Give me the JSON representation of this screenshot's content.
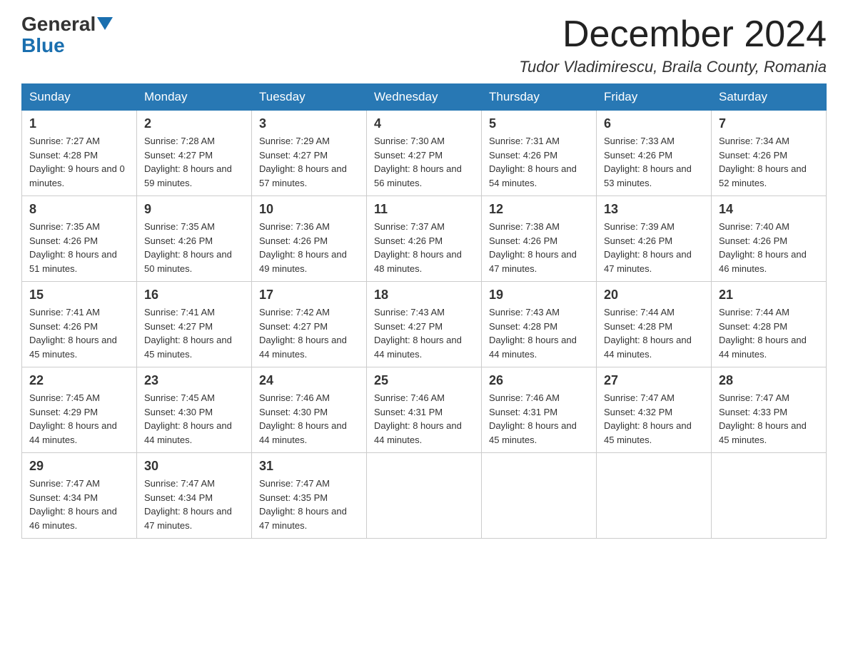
{
  "header": {
    "logo_line1": "General",
    "logo_line2": "Blue",
    "month_title": "December 2024",
    "location": "Tudor Vladimirescu, Braila County, Romania"
  },
  "calendar": {
    "headers": [
      "Sunday",
      "Monday",
      "Tuesday",
      "Wednesday",
      "Thursday",
      "Friday",
      "Saturday"
    ],
    "weeks": [
      [
        {
          "day": "1",
          "sunrise": "7:27 AM",
          "sunset": "4:28 PM",
          "daylight": "9 hours and 0 minutes."
        },
        {
          "day": "2",
          "sunrise": "7:28 AM",
          "sunset": "4:27 PM",
          "daylight": "8 hours and 59 minutes."
        },
        {
          "day": "3",
          "sunrise": "7:29 AM",
          "sunset": "4:27 PM",
          "daylight": "8 hours and 57 minutes."
        },
        {
          "day": "4",
          "sunrise": "7:30 AM",
          "sunset": "4:27 PM",
          "daylight": "8 hours and 56 minutes."
        },
        {
          "day": "5",
          "sunrise": "7:31 AM",
          "sunset": "4:26 PM",
          "daylight": "8 hours and 54 minutes."
        },
        {
          "day": "6",
          "sunrise": "7:33 AM",
          "sunset": "4:26 PM",
          "daylight": "8 hours and 53 minutes."
        },
        {
          "day": "7",
          "sunrise": "7:34 AM",
          "sunset": "4:26 PM",
          "daylight": "8 hours and 52 minutes."
        }
      ],
      [
        {
          "day": "8",
          "sunrise": "7:35 AM",
          "sunset": "4:26 PM",
          "daylight": "8 hours and 51 minutes."
        },
        {
          "day": "9",
          "sunrise": "7:35 AM",
          "sunset": "4:26 PM",
          "daylight": "8 hours and 50 minutes."
        },
        {
          "day": "10",
          "sunrise": "7:36 AM",
          "sunset": "4:26 PM",
          "daylight": "8 hours and 49 minutes."
        },
        {
          "day": "11",
          "sunrise": "7:37 AM",
          "sunset": "4:26 PM",
          "daylight": "8 hours and 48 minutes."
        },
        {
          "day": "12",
          "sunrise": "7:38 AM",
          "sunset": "4:26 PM",
          "daylight": "8 hours and 47 minutes."
        },
        {
          "day": "13",
          "sunrise": "7:39 AM",
          "sunset": "4:26 PM",
          "daylight": "8 hours and 47 minutes."
        },
        {
          "day": "14",
          "sunrise": "7:40 AM",
          "sunset": "4:26 PM",
          "daylight": "8 hours and 46 minutes."
        }
      ],
      [
        {
          "day": "15",
          "sunrise": "7:41 AM",
          "sunset": "4:26 PM",
          "daylight": "8 hours and 45 minutes."
        },
        {
          "day": "16",
          "sunrise": "7:41 AM",
          "sunset": "4:27 PM",
          "daylight": "8 hours and 45 minutes."
        },
        {
          "day": "17",
          "sunrise": "7:42 AM",
          "sunset": "4:27 PM",
          "daylight": "8 hours and 44 minutes."
        },
        {
          "day": "18",
          "sunrise": "7:43 AM",
          "sunset": "4:27 PM",
          "daylight": "8 hours and 44 minutes."
        },
        {
          "day": "19",
          "sunrise": "7:43 AM",
          "sunset": "4:28 PM",
          "daylight": "8 hours and 44 minutes."
        },
        {
          "day": "20",
          "sunrise": "7:44 AM",
          "sunset": "4:28 PM",
          "daylight": "8 hours and 44 minutes."
        },
        {
          "day": "21",
          "sunrise": "7:44 AM",
          "sunset": "4:28 PM",
          "daylight": "8 hours and 44 minutes."
        }
      ],
      [
        {
          "day": "22",
          "sunrise": "7:45 AM",
          "sunset": "4:29 PM",
          "daylight": "8 hours and 44 minutes."
        },
        {
          "day": "23",
          "sunrise": "7:45 AM",
          "sunset": "4:30 PM",
          "daylight": "8 hours and 44 minutes."
        },
        {
          "day": "24",
          "sunrise": "7:46 AM",
          "sunset": "4:30 PM",
          "daylight": "8 hours and 44 minutes."
        },
        {
          "day": "25",
          "sunrise": "7:46 AM",
          "sunset": "4:31 PM",
          "daylight": "8 hours and 44 minutes."
        },
        {
          "day": "26",
          "sunrise": "7:46 AM",
          "sunset": "4:31 PM",
          "daylight": "8 hours and 45 minutes."
        },
        {
          "day": "27",
          "sunrise": "7:47 AM",
          "sunset": "4:32 PM",
          "daylight": "8 hours and 45 minutes."
        },
        {
          "day": "28",
          "sunrise": "7:47 AM",
          "sunset": "4:33 PM",
          "daylight": "8 hours and 45 minutes."
        }
      ],
      [
        {
          "day": "29",
          "sunrise": "7:47 AM",
          "sunset": "4:34 PM",
          "daylight": "8 hours and 46 minutes."
        },
        {
          "day": "30",
          "sunrise": "7:47 AM",
          "sunset": "4:34 PM",
          "daylight": "8 hours and 47 minutes."
        },
        {
          "day": "31",
          "sunrise": "7:47 AM",
          "sunset": "4:35 PM",
          "daylight": "8 hours and 47 minutes."
        },
        null,
        null,
        null,
        null
      ]
    ]
  }
}
